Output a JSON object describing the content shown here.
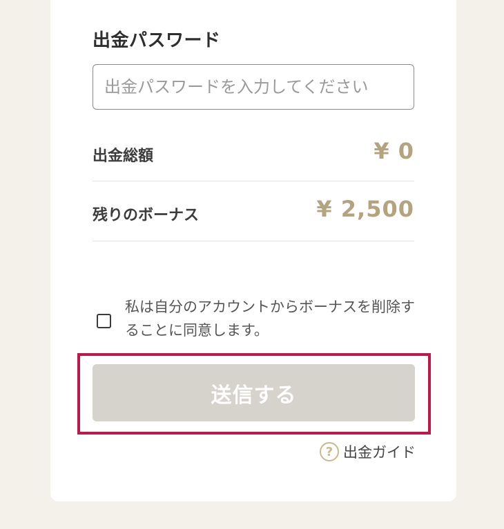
{
  "password": {
    "title": "出金パスワード",
    "placeholder": "出金パスワードを入力してください",
    "value": ""
  },
  "summary": {
    "total_label": "出金総額",
    "total_amount": "¥ 0",
    "bonus_label": "残りのボーナス",
    "bonus_amount": "¥ 2,500"
  },
  "consent": {
    "checked": false,
    "text": "私は自分のアカウントからボーナスを削除することに同意します。"
  },
  "submit": {
    "label": "送信する",
    "enabled": false
  },
  "guide": {
    "label": "出金ガイド",
    "icon": "question-circle-icon",
    "icon_glyph": "?"
  },
  "colors": {
    "amount": "#b3a37e",
    "highlight": "#c0174b",
    "button_disabled": "#d6d3cc",
    "page_background": "#f4f1ea"
  }
}
